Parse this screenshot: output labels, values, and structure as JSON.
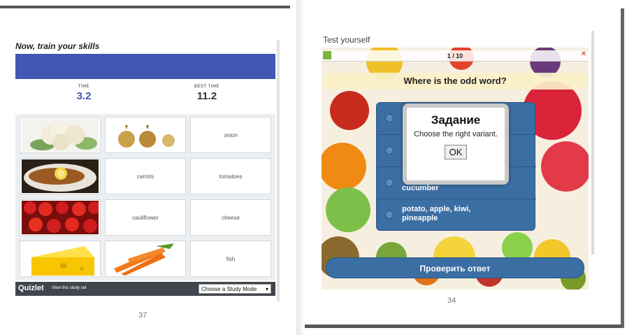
{
  "left_page": {
    "heading": "Now, train your skills",
    "time_label": "TIME",
    "time_value": "3.2",
    "best_label": "BEST TIME",
    "best_value": "11.2",
    "tiles": [
      {
        "kind": "image",
        "name": "cauliflower-image"
      },
      {
        "kind": "image",
        "name": "onions-image"
      },
      {
        "kind": "text",
        "label": "onion"
      },
      {
        "kind": "image",
        "name": "fish-dish-image"
      },
      {
        "kind": "text",
        "label": "carrots"
      },
      {
        "kind": "text",
        "label": "tomatoes"
      },
      {
        "kind": "image",
        "name": "tomatoes-image"
      },
      {
        "kind": "text",
        "label": "cauliflower"
      },
      {
        "kind": "text",
        "label": "cheese"
      },
      {
        "kind": "image",
        "name": "cheese-image"
      },
      {
        "kind": "image",
        "name": "carrots-image"
      },
      {
        "kind": "text",
        "label": "fish"
      }
    ],
    "footer_brand": "Quizlet",
    "footer_link": "View this study set",
    "footer_select": "Choose a Study Mode",
    "page_number": "37"
  },
  "right_page": {
    "title": "Test yourself",
    "progress": "1 / 10",
    "question": "Where is the odd word?",
    "answers": [
      {
        "label": ""
      },
      {
        "label": ""
      },
      {
        "label": "cucumber"
      },
      {
        "label": "potato, apple, kiwi, pineapple"
      }
    ],
    "modal_title": "Задание",
    "modal_text": "Choose the right variant.",
    "modal_ok": "OK",
    "check_button": "Проверить ответ",
    "page_number": "34"
  },
  "colors": {
    "quizlet_blue": "#4257b2",
    "quizlet_bar": "#40464d",
    "quiz_blue": "#3b6ea2"
  }
}
